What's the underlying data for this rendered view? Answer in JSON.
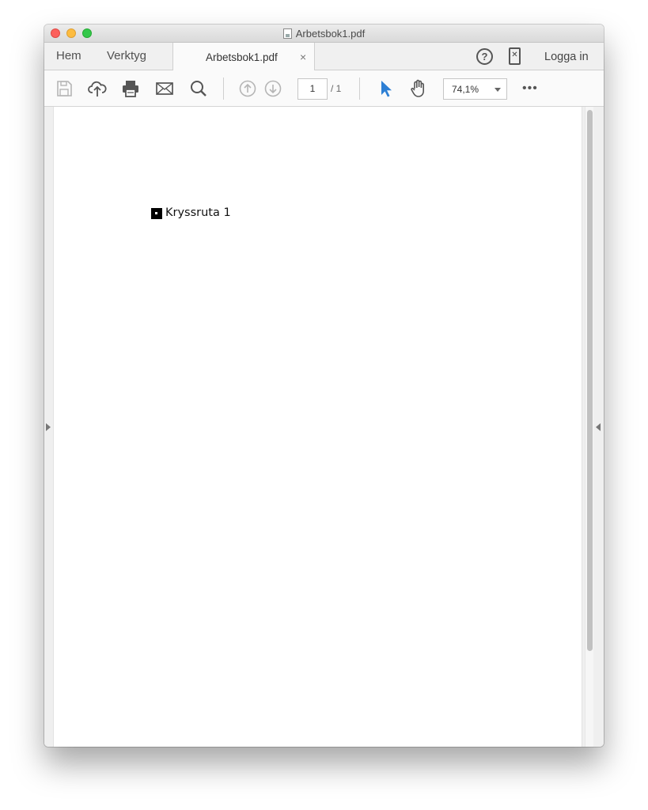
{
  "window": {
    "title": "Arbetsbok1.pdf"
  },
  "tabs": {
    "home": "Hem",
    "tools": "Verktyg",
    "document": "Arbetsbok1.pdf",
    "close_glyph": "×"
  },
  "header": {
    "help_glyph": "?",
    "login": "Logga in"
  },
  "toolbar": {
    "page_current": "1",
    "page_total": "/ 1",
    "zoom": "74,1%",
    "more_glyph": "•••",
    "accent_color": "#2d7fd4"
  },
  "document": {
    "checkbox_label": "Kryssruta 1"
  }
}
